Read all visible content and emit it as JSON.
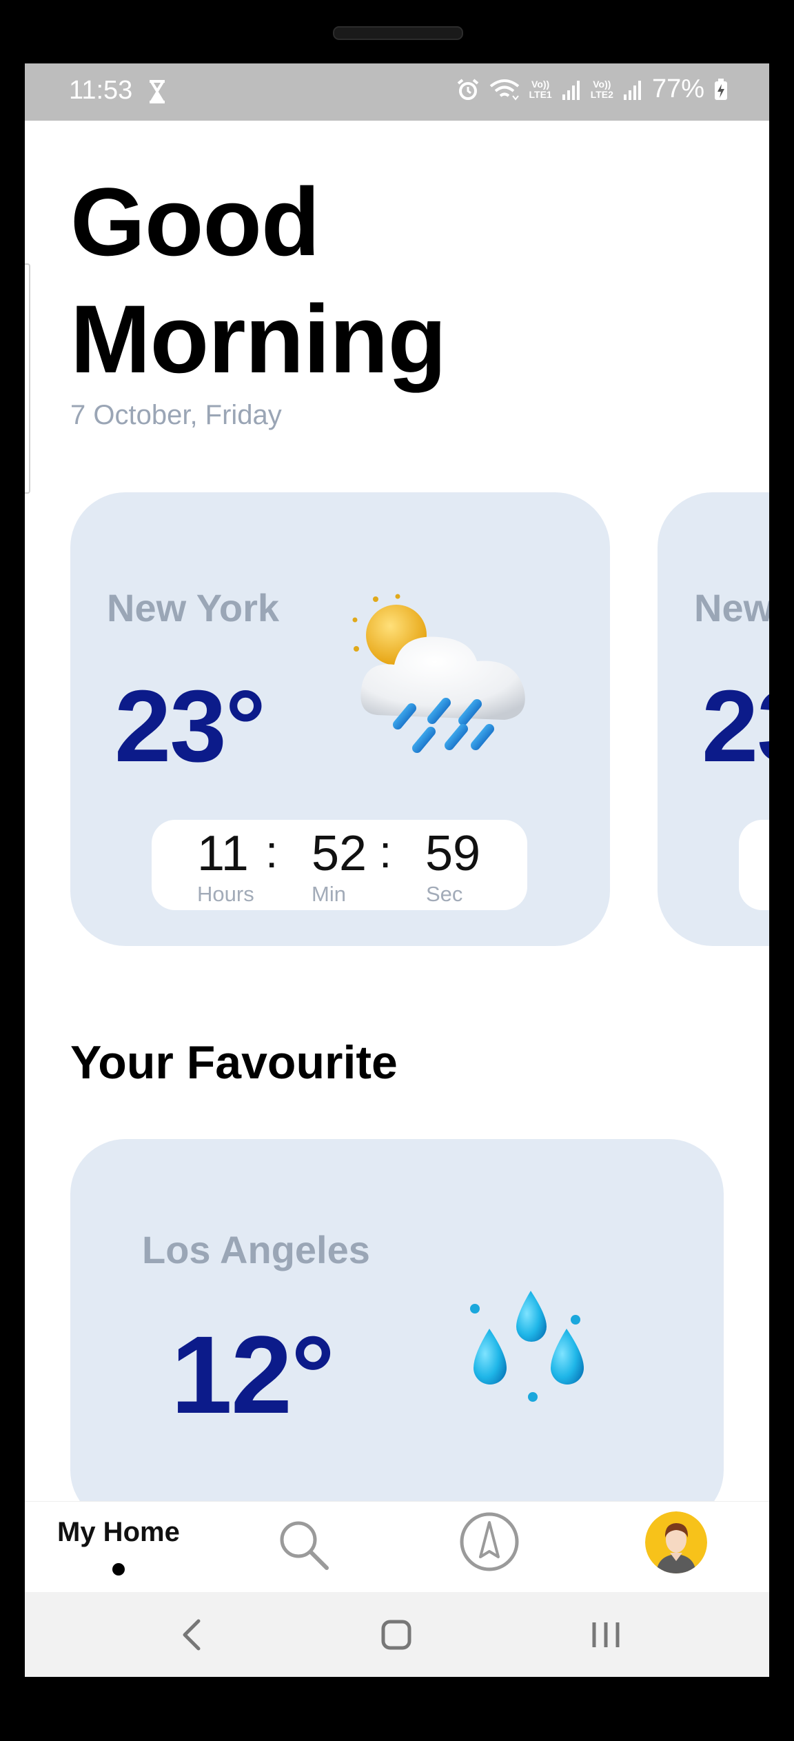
{
  "status_bar": {
    "time": "11:53",
    "battery": "77%",
    "sim1": [
      "Vo))",
      "LTE1"
    ],
    "sim2": [
      "Vo))",
      "LTE2"
    ],
    "icons": [
      "hourglass-icon",
      "alarm-icon",
      "wifi-icon",
      "signal-icon",
      "battery-charging-icon"
    ]
  },
  "greeting": {
    "line1": "Good",
    "line2": "Morning"
  },
  "date": "7 October, Friday",
  "cities": [
    {
      "name": "New York",
      "temp": "23°",
      "icon": "sun-cloud-rain-icon",
      "timer": {
        "hours": "11",
        "minutes": "52",
        "seconds": "59",
        "hours_label": "Hours",
        "minutes_label": "Min",
        "seconds_label": "Sec",
        "colon": ":"
      }
    },
    {
      "name": "New",
      "temp": "23"
    }
  ],
  "favourites": {
    "title": "Your Favourite",
    "items": [
      {
        "name": "Los Angeles",
        "temp": "12°",
        "icon": "rain-drops-icon"
      }
    ]
  },
  "bottom_nav": {
    "home_label": "My Home",
    "items": [
      "home-tab",
      "search-icon",
      "compass-icon",
      "avatar"
    ]
  },
  "colors": {
    "card_bg": "#e2eaf4",
    "temp": "#0c1b8a",
    "muted": "#9aa6b6",
    "status_bar": "#bdbdbd"
  }
}
